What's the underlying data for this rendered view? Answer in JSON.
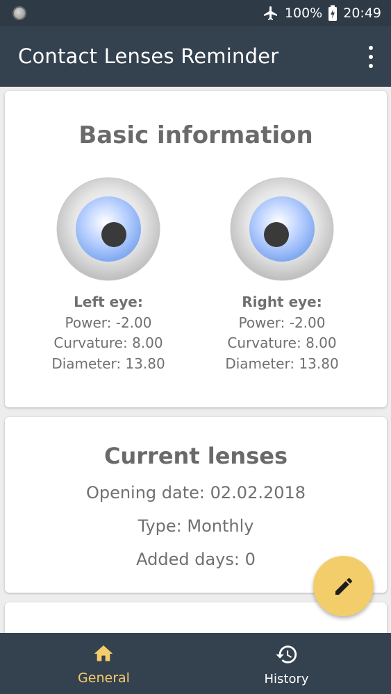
{
  "status_bar": {
    "battery": "100%",
    "time": "20:49",
    "icons": [
      "notification-dot-icon",
      "airplane-mode-icon",
      "battery-charging-icon"
    ]
  },
  "app_bar": {
    "title": "Contact Lenses Reminder",
    "menu_icon": "more-vert-icon"
  },
  "basic_info": {
    "title": "Basic information",
    "left_eye": {
      "label": "Left eye:",
      "power": "Power: -2.00",
      "curvature": "Curvature: 8.00",
      "diameter": "Diameter: 13.80"
    },
    "right_eye": {
      "label": "Right eye:",
      "power": "Power: -2.00",
      "curvature": "Curvature: 8.00",
      "diameter": "Diameter: 13.80"
    }
  },
  "current_lenses": {
    "title": "Current lenses",
    "opening_date": "Opening date: 02.02.2018",
    "type": "Type: Monthly",
    "added_days": "Added days: 0"
  },
  "fab": {
    "icon": "edit-pencil-icon"
  },
  "bottom_nav": {
    "items": [
      {
        "label": "General",
        "icon": "home-icon",
        "active": true
      },
      {
        "label": "History",
        "icon": "history-icon",
        "active": false
      }
    ]
  },
  "colors": {
    "status_bar": "#2f3a47",
    "app_bar": "#34414f",
    "accent": "#f4cd6b",
    "text_gray": "#707070",
    "iris": "#a9c8ff"
  }
}
